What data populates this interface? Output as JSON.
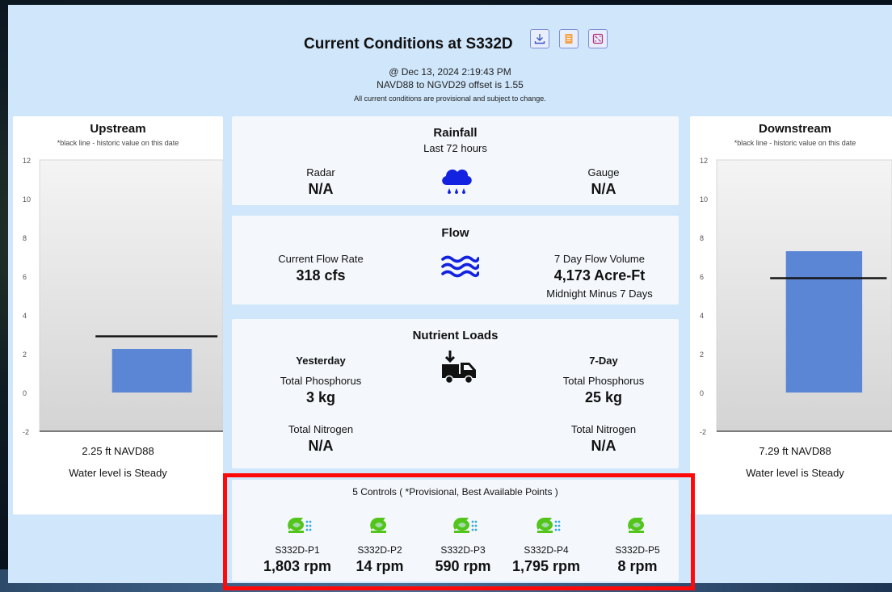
{
  "header": {
    "title": "Current Conditions at S332D",
    "timestamp": "@ Dec 13, 2024 2:19:43 PM",
    "offset": "NAVD88 to NGVD29 offset is 1.55",
    "disclaimer": "All current conditions are provisional and subject to change.",
    "buttons": [
      "download-icon",
      "document-icon",
      "expand-icon"
    ]
  },
  "upstream": {
    "title": "Upstream",
    "note": "*black line - historic value on this date",
    "value_text": "2.25 ft NAVD88",
    "status": "Water level is Steady",
    "chart_data": {
      "type": "bar",
      "categories": [
        ""
      ],
      "values": [
        2.25
      ],
      "historic": 2.9,
      "ylim": [
        -2,
        12
      ],
      "ticks": [
        12,
        10,
        8,
        6,
        4,
        2,
        0,
        -2
      ],
      "color": "#5b86d6"
    }
  },
  "downstream": {
    "title": "Downstream",
    "note": "*black line - historic value on this date",
    "value_text": "7.29 ft NAVD88",
    "status": "Water level is Steady",
    "chart_data": {
      "type": "bar",
      "categories": [
        ""
      ],
      "values": [
        7.29
      ],
      "historic": 5.9,
      "ylim": [
        -2,
        12
      ],
      "ticks": [
        12,
        10,
        8,
        6,
        4,
        2,
        0,
        -2
      ],
      "color": "#5b86d6"
    }
  },
  "rainfall": {
    "title": "Rainfall",
    "subtitle": "Last 72 hours",
    "radar_label": "Radar",
    "radar_value": "N/A",
    "gauge_label": "Gauge",
    "gauge_value": "N/A",
    "icon": "rain-cloud-icon"
  },
  "flow": {
    "title": "Flow",
    "current_label": "Current Flow Rate",
    "current_value": "318 cfs",
    "volume_label": "7 Day Flow Volume",
    "volume_value": "4,173 Acre-Ft",
    "volume_note": "Midnight Minus 7 Days",
    "icon": "water-waves-icon"
  },
  "nutrients": {
    "title": "Nutrient Loads",
    "yesterday_label": "Yesterday",
    "week_label": "7-Day",
    "phosphorus_label": "Total Phosphorus",
    "nitrogen_label": "Total Nitrogen",
    "yesterday_phosphorus": "3 kg",
    "week_phosphorus": "25 kg",
    "yesterday_nitrogen": "N/A",
    "week_nitrogen": "N/A",
    "icon": "truck-unload-icon"
  },
  "controls": {
    "title": "5 Controls ( *Provisional, Best Available Points )",
    "items": [
      {
        "name": "S332D-P1",
        "value": "1,803 rpm",
        "active": true
      },
      {
        "name": "S332D-P2",
        "value": "14 rpm",
        "active": false
      },
      {
        "name": "S332D-P3",
        "value": "590 rpm",
        "active": true
      },
      {
        "name": "S332D-P4",
        "value": "1,795 rpm",
        "active": true
      },
      {
        "name": "S332D-P5",
        "value": "8 rpm",
        "active": false
      }
    ],
    "pump_color": "#52c41a",
    "flow_dots_color": "#35a8e0"
  }
}
